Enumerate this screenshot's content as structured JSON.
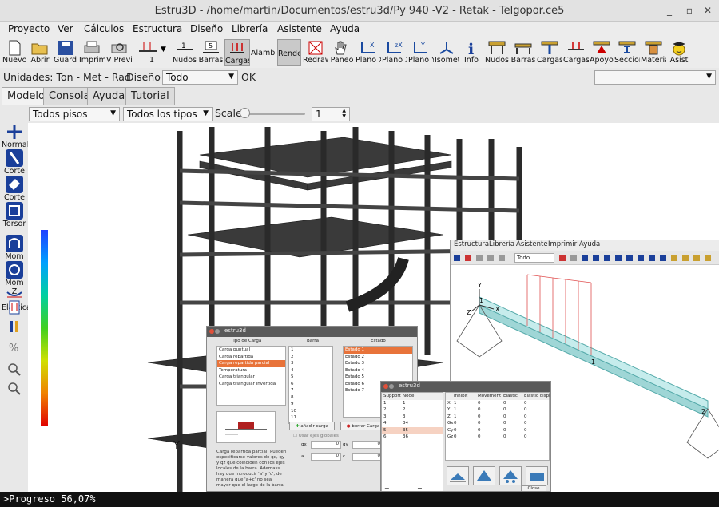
{
  "window": {
    "title": "Estru3D - /home/martin/Documentos/estru3d/Py 940 -V2 - Retak - Telgopor.ce5",
    "min": "_",
    "max": "▫",
    "close": "✕"
  },
  "menu": [
    "Proyecto",
    "Ver",
    "Cálculos",
    "Estructura",
    "Diseño",
    "Librería",
    "Asistente",
    "Ayuda"
  ],
  "toolbar": [
    {
      "label": "Nuevo"
    },
    {
      "label": "Abrir"
    },
    {
      "label": "Guardar"
    },
    {
      "label": "Imprimir"
    },
    {
      "label": "V Previa"
    },
    {
      "label": "1"
    },
    {
      "label": "Nudos"
    },
    {
      "label": "Barras"
    },
    {
      "label": "Cargas"
    },
    {
      "label": "Alambric"
    },
    {
      "label": "Render"
    },
    {
      "label": "Redraw"
    },
    {
      "label": "Paneo"
    },
    {
      "label": "Plano XY"
    },
    {
      "label": "Plano XZ"
    },
    {
      "label": "Plano YZ"
    },
    {
      "label": "Isomet"
    },
    {
      "label": "Info"
    },
    {
      "label": "Nudos"
    },
    {
      "label": "Barras"
    },
    {
      "label": "Cargas"
    },
    {
      "label": "Cargas P"
    },
    {
      "label": "Apoyos"
    },
    {
      "label": "Seccion"
    },
    {
      "label": "Materia"
    },
    {
      "label": "Asist"
    }
  ],
  "units": {
    "label": "Unidades: Ton - Met - Rad",
    "diseno_label": "Diseño",
    "diseno_value": "Todo",
    "ok": "OK"
  },
  "tabs": [
    "Modelo",
    "Consola",
    "Ayuda",
    "Tutorial"
  ],
  "filters": {
    "pisos": "Todos pisos",
    "tipos": "Todos los tipos",
    "scale_label": "Scale",
    "scale_value": "1"
  },
  "left_tools": [
    "Normal",
    "Corte Y",
    "Corte Z",
    "Torsor",
    "Mom Y",
    "Mom Z",
    "Elastica"
  ],
  "viewport": {
    "axis_y": "Y"
  },
  "status": {
    "text": ">Progreso 56,07%"
  },
  "inner_window": {
    "menu": [
      "Estructura",
      "Librería",
      "Asistente",
      "Imprimir",
      "Ayuda"
    ],
    "combo": "Todo",
    "labels": {
      "y": "Y",
      "z": "Z",
      "x": "X",
      "n1": "1",
      "n2": "2"
    }
  },
  "load_dialog": {
    "title": "estru3d",
    "col_headers": [
      "Tipo de Carga",
      "Barra",
      "Estado"
    ],
    "load_types": [
      "Carga puntual",
      "Carga repartida",
      "Carga repartida parcial",
      "Temperatura",
      "Carga triangular",
      "Carga triangular invertida"
    ],
    "selected_type": 2,
    "bars": [
      "1",
      "2",
      "3",
      "4",
      "5",
      "6",
      "7",
      "8",
      "9",
      "10",
      "11"
    ],
    "states": [
      "Estado 1",
      "Estado 2",
      "Estado 3",
      "Estado 4",
      "Estado 5",
      "Estado 6",
      "Estado 7"
    ],
    "selected_state": 0,
    "add_button": "añadir carga",
    "remove_button": "borrar Carga",
    "checkbox": "Usar ejes globales",
    "fields": [
      {
        "name": "qx",
        "value": "0"
      },
      {
        "name": "qy",
        "value": "0"
      },
      {
        "name": "a",
        "value": "0"
      },
      {
        "name": "c",
        "value": "0"
      }
    ],
    "description": "Carga repartida parcial: Pueden especificarse valores de qx, qy y qz que coinciden con los ejes locales de la barra. Ademass hay que introducir 'a' y 'c', de manera que 'a+c' no sea mayor que el largo de la barra."
  },
  "support_dialog": {
    "title": "estru3d",
    "headers": [
      "Support",
      "Node"
    ],
    "rows": [
      [
        "1",
        "1"
      ],
      [
        "2",
        "2"
      ],
      [
        "3",
        "3"
      ],
      [
        "4",
        "34"
      ],
      [
        "5",
        "35"
      ],
      [
        "6",
        "36"
      ]
    ],
    "selected_row": 4,
    "right_headers": [
      "",
      "Inhibit",
      "Movement",
      "Elastic",
      "Elastic displac"
    ],
    "right_rows": [
      [
        "X",
        "1",
        "0",
        "0",
        "0"
      ],
      [
        "Y",
        "1",
        "0",
        "0",
        "0"
      ],
      [
        "Z",
        "1",
        "0",
        "0",
        "0"
      ],
      [
        "Gx",
        "0",
        "0",
        "0",
        "0"
      ],
      [
        "Gy",
        "0",
        "0",
        "0",
        "0"
      ],
      [
        "Gz",
        "0",
        "0",
        "0",
        "0"
      ]
    ],
    "add": "+",
    "remove": "−",
    "close": "Close"
  },
  "colors": {
    "selection": "#e8733a",
    "beam": "#9fd6d6",
    "load": "#e05050"
  }
}
